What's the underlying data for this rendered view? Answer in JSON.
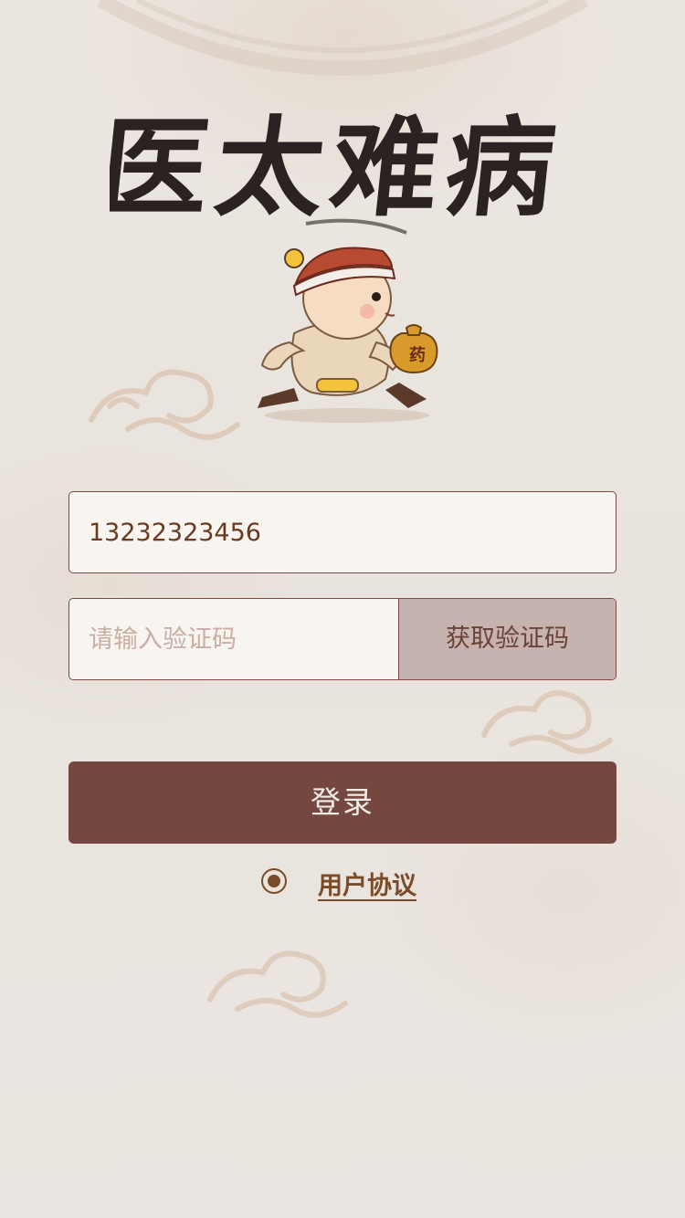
{
  "app": {
    "logo_text": "医太难病"
  },
  "mascot": {
    "bag_label": "药"
  },
  "login_form": {
    "phone_value": "13232323456",
    "code_placeholder": "请输入验证码",
    "get_code_label": "获取验证码",
    "login_label": "登录"
  },
  "agreement": {
    "checked": true,
    "link_label": "用户协议"
  },
  "colors": {
    "background": "#ebe5df",
    "field_border": "#7a4a42",
    "login_button": "#744840",
    "code_button": "#c6b2ae",
    "accent_brown": "#7b4a26"
  }
}
